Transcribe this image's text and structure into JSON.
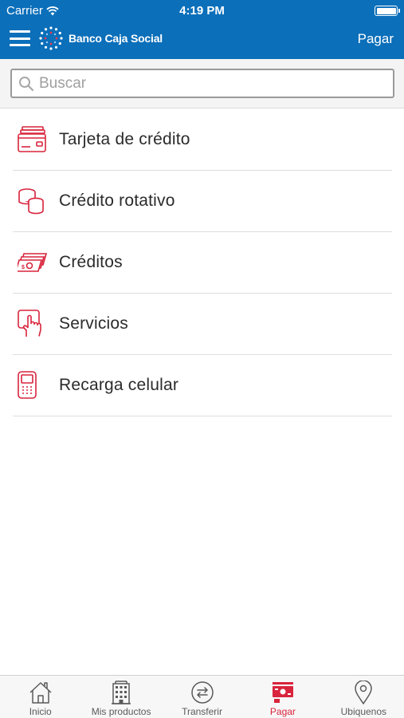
{
  "status_bar": {
    "carrier": "Carrier",
    "time": "4:19 PM"
  },
  "header": {
    "brand": "Banco Caja Social",
    "action_label": "Pagar"
  },
  "search": {
    "placeholder": "Buscar",
    "value": ""
  },
  "menu": {
    "items": [
      {
        "label": "Tarjeta de crédito",
        "icon": "credit-card-icon"
      },
      {
        "label": "Crédito rotativo",
        "icon": "coins-stack-icon"
      },
      {
        "label": "Créditos",
        "icon": "money-bills-icon"
      },
      {
        "label": "Servicios",
        "icon": "touch-screen-icon"
      },
      {
        "label": "Recarga celular",
        "icon": "mobile-phone-icon"
      }
    ]
  },
  "tabbar": {
    "tabs": [
      {
        "label": "Inicio",
        "icon": "home-icon",
        "active": false
      },
      {
        "label": "Mis productos",
        "icon": "building-icon",
        "active": false
      },
      {
        "label": "Transferir",
        "icon": "transfer-arrows-icon",
        "active": false
      },
      {
        "label": "Pagar",
        "icon": "payment-icon",
        "active": true
      },
      {
        "label": "Ubiquenos",
        "icon": "location-pin-icon",
        "active": false
      }
    ]
  },
  "colors": {
    "header_bg": "#0b6fba",
    "accent_red": "#d8243c",
    "tab_inactive": "#5a5a5a"
  }
}
